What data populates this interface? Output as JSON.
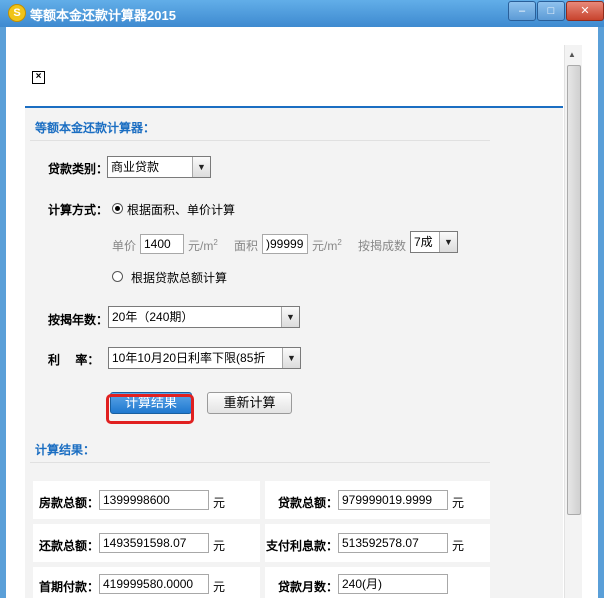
{
  "window": {
    "title": "等额本金还款计算器2015",
    "app_icon": "S",
    "min": "–",
    "max": "□",
    "close": "✕"
  },
  "checkbox_x": "×",
  "form": {
    "heading": "等额本金还款计算器：",
    "loan_type_label": "贷款类别：",
    "loan_type_value": "商业贷款",
    "calc_method_label": "计算方式：",
    "radio_area_label": "根据面积、单价计算",
    "unit_price_label": "单价",
    "unit_price_value": "1400",
    "unit_price_unit": "元/m",
    "area_label": "面积",
    "area_value": ")99999",
    "area_unit": "元/m",
    "sup2": "2",
    "ratio_label": "按揭成数",
    "ratio_value": "7成",
    "radio_total_label": "根据贷款总额计算",
    "years_label": "按揭年数：",
    "years_value": "20年（240期）",
    "rate_label": "利　 率：",
    "rate_value": "10年10月20日利率下限(85折",
    "calc_button": "计算结果",
    "reset_button": "重新计算"
  },
  "results": {
    "heading": "计算结果：",
    "house_total_label": "房款总额：",
    "house_total_value": "1399998600",
    "loan_total_label": "贷款总额：",
    "loan_total_value": "979999019.9999",
    "repay_total_label": "还款总额：",
    "repay_total_value": "1493591598.07",
    "interest_label": "支付利息款：",
    "interest_value": "513592578.07",
    "down_payment_label": "首期付款：",
    "down_payment_value": "419999580.0000",
    "months_label": "贷款月数：",
    "months_value": "240(月)",
    "unit_yuan": "元"
  },
  "colors": {
    "accent": "#1b6ec2",
    "highlight_box": "#e02020",
    "primary_button": "#1f78cf"
  }
}
